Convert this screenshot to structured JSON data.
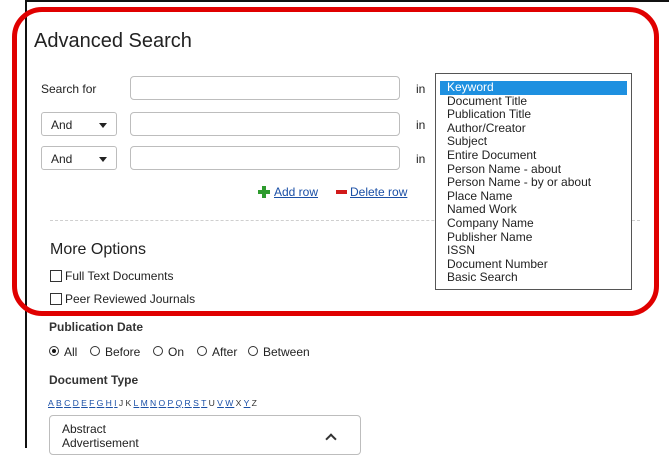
{
  "title": "Advanced Search",
  "search_rows": [
    {
      "label": "Search for",
      "connector": null,
      "in": "in",
      "value": ""
    },
    {
      "label": null,
      "connector": "And",
      "in": "in",
      "value": ""
    },
    {
      "label": null,
      "connector": "And",
      "in": "in",
      "value": ""
    }
  ],
  "row_actions": {
    "add": "Add row",
    "delete": "Delete row"
  },
  "field_options": [
    "Keyword",
    "Document Title",
    "Publication Title",
    "Author/Creator",
    "Subject",
    "Entire Document",
    "Person Name - about",
    "Person Name - by or about",
    "Place Name",
    "Named Work",
    "Company Name",
    "Publisher Name",
    "ISSN",
    "Document Number",
    "Basic Search"
  ],
  "field_selected": "Keyword",
  "more_options": {
    "title": "More Options",
    "checkboxes": [
      {
        "label": "Full Text Documents",
        "checked": false
      },
      {
        "label": "Peer Reviewed Journals",
        "checked": false
      }
    ]
  },
  "publication_date": {
    "title": "Publication Date",
    "options": [
      "All",
      "Before",
      "On",
      "After",
      "Between"
    ],
    "selected": "All"
  },
  "document_type": {
    "title": "Document Type",
    "alphabet": [
      {
        "l": "A",
        "link": true
      },
      {
        "l": "B",
        "link": true
      },
      {
        "l": "C",
        "link": true
      },
      {
        "l": "D",
        "link": true
      },
      {
        "l": "E",
        "link": true
      },
      {
        "l": "F",
        "link": true
      },
      {
        "l": "G",
        "link": true
      },
      {
        "l": "H",
        "link": true
      },
      {
        "l": "I",
        "link": true
      },
      {
        "l": "J",
        "link": false
      },
      {
        "l": "K",
        "link": false
      },
      {
        "l": "L",
        "link": true
      },
      {
        "l": "M",
        "link": true
      },
      {
        "l": "N",
        "link": true
      },
      {
        "l": "O",
        "link": true
      },
      {
        "l": "P",
        "link": true
      },
      {
        "l": "Q",
        "link": true
      },
      {
        "l": "R",
        "link": true
      },
      {
        "l": "S",
        "link": true
      },
      {
        "l": "T",
        "link": true
      },
      {
        "l": "U",
        "link": false
      },
      {
        "l": "V",
        "link": true
      },
      {
        "l": "W",
        "link": true
      },
      {
        "l": "X",
        "link": false
      },
      {
        "l": "Y",
        "link": true
      },
      {
        "l": "Z",
        "link": false
      }
    ],
    "items": [
      "Abstract",
      "Advertisement"
    ]
  },
  "colors": {
    "highlight": "#e00000",
    "link": "#1a4fa6",
    "selection": "#1e90e0"
  }
}
